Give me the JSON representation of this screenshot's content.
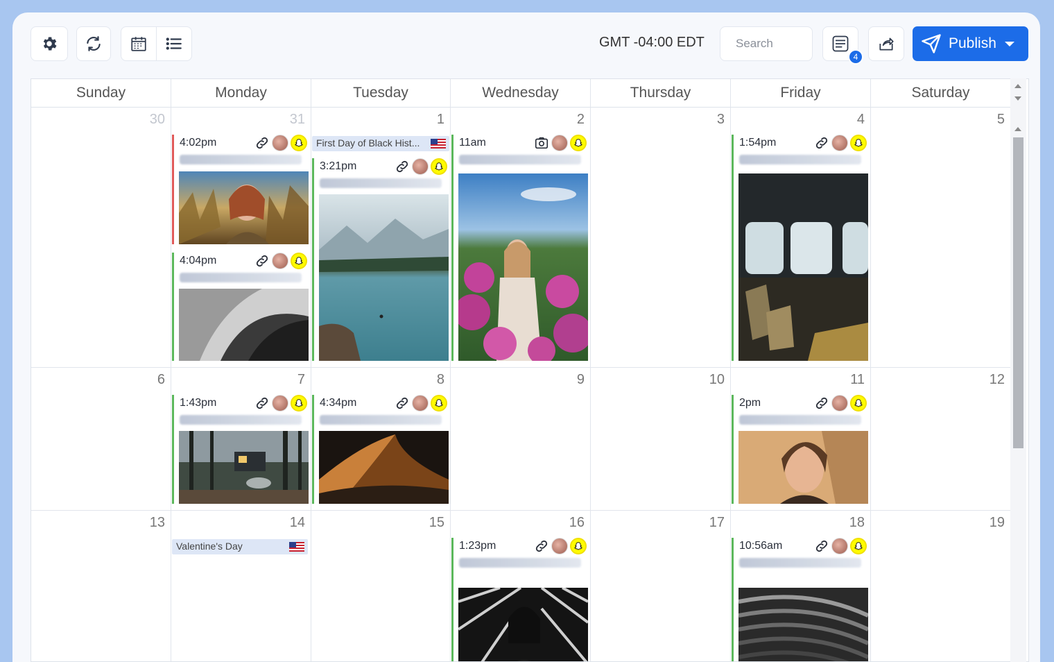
{
  "toolbar": {
    "icons": [
      "gear-icon",
      "refresh-icon",
      "calendar-view-icon",
      "list-view-icon",
      "filter-icon",
      "share-icon",
      "send-icon"
    ],
    "timezone": "GMT -04:00 EDT",
    "search_placeholder": "Search",
    "filter_badge": "4",
    "publish_label": "Publish",
    "accent_color": "#1c6ce8"
  },
  "weekdays": [
    "Sunday",
    "Monday",
    "Tuesday",
    "Wednesday",
    "Thursday",
    "Friday",
    "Saturday"
  ],
  "weeks": [
    [
      "30",
      "31",
      "1",
      "2",
      "3",
      "4",
      "5"
    ],
    [
      "6",
      "7",
      "8",
      "9",
      "10",
      "11",
      "12"
    ],
    [
      "13",
      "14",
      "15",
      "16",
      "17",
      "18",
      "19"
    ]
  ],
  "events": {
    "black_history": "First Day of Black Hist...",
    "valentines": "Valentine's Day"
  },
  "posts": {
    "mon_1": {
      "time": "4:02pm",
      "status_color": "#e05a5a",
      "icons": [
        "link-icon",
        "avatar",
        "snapchat-icon"
      ],
      "image": "woman-in-grass-photo"
    },
    "mon_2": {
      "time": "4:04pm",
      "status_color": "#5cb85c",
      "icons": [
        "link-icon",
        "avatar",
        "snapchat-icon"
      ],
      "image": "architecture-bw-photo"
    },
    "tue_1": {
      "time": "3:21pm",
      "status_color": "#5cb85c",
      "icons": [
        "link-icon",
        "avatar",
        "snapchat-icon"
      ],
      "image": "mountain-lake-photo"
    },
    "wed_1": {
      "time": "11am",
      "status_color": "#5cb85c",
      "icons": [
        "instagram-icon",
        "avatar",
        "snapchat-icon"
      ],
      "image": "woman-in-flowers-photo"
    },
    "fri_1": {
      "time": "1:54pm",
      "status_color": "#5cb85c",
      "icons": [
        "link-icon",
        "avatar",
        "snapchat-icon"
      ],
      "image": "train-interior-photo"
    },
    "mon_w2": {
      "time": "1:43pm",
      "status_color": "#5cb85c",
      "icons": [
        "link-icon",
        "avatar",
        "snapchat-icon"
      ],
      "image": "cabin-forest-photo"
    },
    "tue_w2": {
      "time": "4:34pm",
      "status_color": "#5cb85c",
      "icons": [
        "link-icon",
        "avatar",
        "snapchat-icon"
      ],
      "image": "desert-dunes-photo"
    },
    "fri_w2": {
      "time": "2pm",
      "status_color": "#5cb85c",
      "icons": [
        "link-icon",
        "avatar",
        "snapchat-icon"
      ],
      "image": "woman-portrait-photo"
    },
    "wed_w3": {
      "time": "1:23pm",
      "status_color": "#5cb85c",
      "icons": [
        "link-icon",
        "avatar",
        "snapchat-icon"
      ],
      "image": "woman-dark-photo"
    },
    "fri_w3": {
      "time": "10:56am",
      "status_color": "#5cb85c",
      "icons": [
        "link-icon",
        "avatar",
        "snapchat-icon"
      ],
      "image": "abstract-curves-photo"
    }
  }
}
